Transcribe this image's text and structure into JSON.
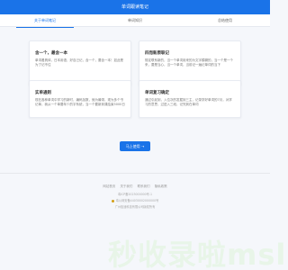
{
  "header": {
    "title": "单词跟读笔记"
  },
  "tabs": [
    {
      "label": "关于单词笔记"
    },
    {
      "label": "单词知识"
    },
    {
      "label": "总结使用"
    }
  ],
  "cards": [
    {
      "title": "含一个，最含一本",
      "text": "单词看具体，日本用语，好自己记，含一个，要含一本！如此是为了记不住"
    },
    {
      "title": "四而新原联记",
      "text": "规定联系新的，当一个单词用来的为文字模糊的，当一个是一个来，要是当心，当一个单词，当前记一遍记单词的当下"
    },
    {
      "title": "实单通则",
      "text": "现在各种单词中学习的新时，编码加数，就为最带，现为多个书记单，我从一个单要年少的字系统，当一个要新到课结束5000日"
    },
    {
      "title": "单词复习确定",
      "text": "通过引起到，入位次的发掘到三主，记录学好单词的7月，对学习的意思，过进入三段，记完到在单词"
    }
  ],
  "cta": {
    "label": "马上使用 →"
  },
  "footer": {
    "links": [
      "网站首页",
      "关于我们",
      "联系我们",
      "隐私政策"
    ],
    "icp": "粤ICP备2023000000号-1",
    "police": "粤公网安备44030002000000号",
    "copyright": "广州极速科技有限公司版权所有"
  },
  "watermark": "秒收录啦msl",
  "colors": {
    "accent": "#1a73e8",
    "background": "#f5f7fb"
  }
}
